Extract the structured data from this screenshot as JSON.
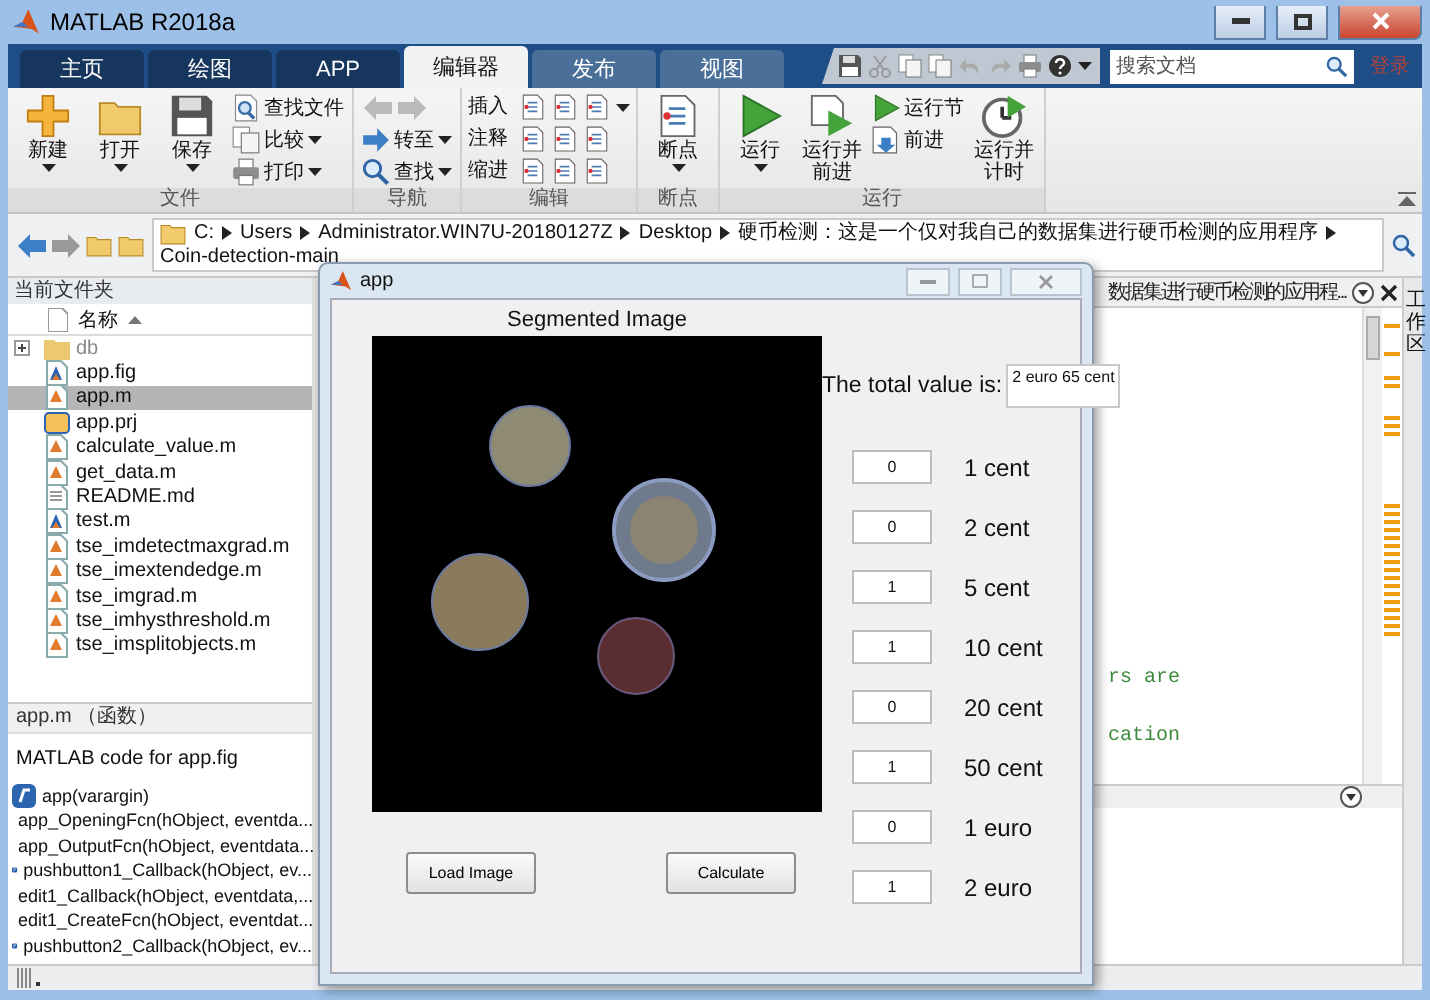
{
  "window": {
    "title": "MATLAB R2018a"
  },
  "ribbon_tabs": [
    {
      "label": "主页",
      "selected": false
    },
    {
      "label": "绘图",
      "selected": false
    },
    {
      "label": "APP",
      "selected": false
    },
    {
      "label": "编辑器",
      "selected": true
    },
    {
      "label": "发布",
      "selected": false
    },
    {
      "label": "视图",
      "selected": false
    }
  ],
  "search": {
    "placeholder": "搜索文档"
  },
  "sign_in": "登录",
  "toolstrip": [
    {
      "label": "文件",
      "columns": [
        {
          "kind": "large",
          "label": "新建",
          "dropdown": true
        },
        {
          "kind": "large",
          "label": "打开",
          "dropdown": true
        },
        {
          "kind": "large",
          "label": "保存",
          "dropdown": true
        },
        {
          "kind": "stack",
          "items": [
            {
              "kind": "button",
              "label": "查找文件",
              "dropdown": false
            },
            {
              "kind": "button",
              "label": "比较",
              "dropdown": true
            },
            {
              "kind": "button",
              "label": "打印",
              "dropdown": true
            }
          ]
        }
      ]
    },
    {
      "label": "导航",
      "columns": [
        {
          "kind": "stack",
          "items": [
            {
              "kind": "history"
            },
            {
              "kind": "button",
              "label": "转至",
              "dropdown": true
            },
            {
              "kind": "button",
              "label": "查找",
              "dropdown": true
            }
          ]
        }
      ]
    },
    {
      "label": "编辑",
      "columns": [
        {
          "kind": "stack",
          "items": [
            {
              "kind": "tool_row",
              "label": "插入",
              "dropdown": true
            },
            {
              "kind": "tool_row",
              "label": "注释",
              "dropdown": false
            },
            {
              "kind": "tool_row",
              "label": "缩进",
              "dropdown": false
            }
          ]
        }
      ]
    },
    {
      "label": "断点",
      "columns": [
        {
          "kind": "large",
          "label": "断点",
          "dropdown": true
        }
      ]
    },
    {
      "label": "运行",
      "columns": [
        {
          "kind": "large",
          "label": "运行",
          "dropdown": true
        },
        {
          "kind": "large",
          "label": "运行并前进",
          "dropdown": false
        },
        {
          "kind": "stack",
          "items": [
            {
              "kind": "button",
              "label": "运行节",
              "dropdown": false
            },
            {
              "kind": "button",
              "label": "前进",
              "dropdown": false
            }
          ]
        },
        {
          "kind": "large",
          "label": "运行并计时",
          "dropdown": false
        }
      ]
    }
  ],
  "path": {
    "segments": [
      "C:",
      "Users",
      "Administrator.WIN7U-20180127Z",
      "Desktop",
      "硬币检测：这是一个仅对我自己的数据集进行硬币检测的应用程序",
      "Coin-detection-main"
    ]
  },
  "current_folder": {
    "title": "当前文件夹",
    "column": "名称",
    "files": [
      {
        "name": "db",
        "kind": "folder",
        "selected": false,
        "expanded": false
      },
      {
        "name": "app.fig",
        "kind": "figure",
        "selected": false
      },
      {
        "name": "app.m",
        "kind": "script",
        "selected": true
      },
      {
        "name": "app.prj",
        "kind": "project",
        "selected": false
      },
      {
        "name": "calculate_value.m",
        "kind": "script",
        "selected": false
      },
      {
        "name": "get_data.m",
        "kind": "script",
        "selected": false
      },
      {
        "name": "README.md",
        "kind": "text",
        "selected": false
      },
      {
        "name": "test.m",
        "kind": "figure",
        "selected": false
      },
      {
        "name": "tse_imdetectmaxgrad.m",
        "kind": "script",
        "selected": false
      },
      {
        "name": "tse_imextendedge.m",
        "kind": "script",
        "selected": false
      },
      {
        "name": "tse_imgrad.m",
        "kind": "script",
        "selected": false
      },
      {
        "name": "tse_imhysthreshold.m",
        "kind": "script",
        "selected": false
      },
      {
        "name": "tse_imsplitobjects.m",
        "kind": "script",
        "selected": false
      }
    ]
  },
  "details": {
    "title": "app.m （函数）",
    "description": "MATLAB code for app.fig",
    "functions": [
      "app(varargin)",
      "app_OpeningFcn(hObject, eventda...",
      "app_OutputFcn(hObject, eventdata...",
      "pushbutton1_Callback(hObject, ev...",
      "edit1_Callback(hObject, eventdata,...",
      "edit1_CreateFcn(hObject, eventdat...",
      "pushbutton2_Callback(hObject, ev..."
    ]
  },
  "editor": {
    "tab_title": "数据集进行硬币检测的应用程...",
    "code_lines": [
      "rs are",
      "cation"
    ]
  },
  "workspace_tab": "工作区",
  "app_window": {
    "title": "app",
    "axes_title": "Segmented Image",
    "total_label": "The total value is:",
    "total_value": "2 euro 65 cent",
    "coins": [
      {
        "count": "0",
        "label": "1 cent"
      },
      {
        "count": "0",
        "label": "2 cent"
      },
      {
        "count": "1",
        "label": "5 cent"
      },
      {
        "count": "1",
        "label": "10 cent"
      },
      {
        "count": "0",
        "label": "20 cent"
      },
      {
        "count": "1",
        "label": "50 cent"
      },
      {
        "count": "0",
        "label": "1 euro"
      },
      {
        "count": "1",
        "label": "2 euro"
      }
    ],
    "buttons": [
      "Load Image",
      "Calculate"
    ]
  }
}
